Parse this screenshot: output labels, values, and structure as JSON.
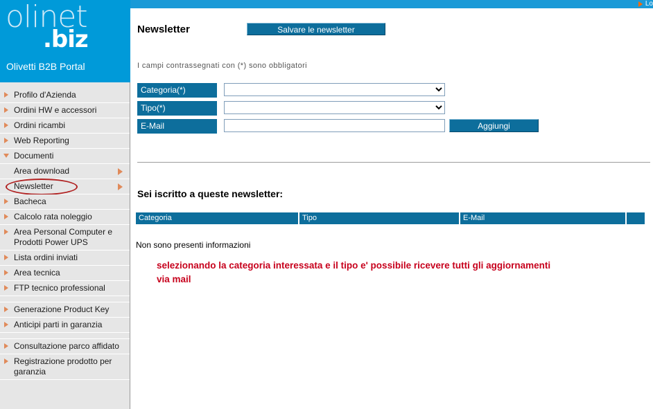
{
  "topbar": {
    "link_label": "Lo",
    "arrow_icon": "play-arrow-icon",
    "bg_color": "#1a9ad7"
  },
  "sidebar": {
    "logo": {
      "line1": "olinet",
      "line2": ".biz",
      "tagline": "Olivetti B2B Portal",
      "bg_color": "#009ad9"
    },
    "items": [
      {
        "label": "Profilo d'Azienda",
        "bullet": "right-arrow-icon",
        "sub": false,
        "submenu_arrow": false,
        "circled": false,
        "spacer_after": false
      },
      {
        "label": "Ordini HW e accessori",
        "bullet": "right-arrow-icon",
        "sub": false,
        "submenu_arrow": false,
        "circled": false,
        "spacer_after": false
      },
      {
        "label": "Ordini ricambi",
        "bullet": "right-arrow-icon",
        "sub": false,
        "submenu_arrow": false,
        "circled": false,
        "spacer_after": false
      },
      {
        "label": "Web Reporting",
        "bullet": "right-arrow-icon",
        "sub": false,
        "submenu_arrow": false,
        "circled": false,
        "spacer_after": false
      },
      {
        "label": "Documenti",
        "bullet": "down-arrow-icon",
        "sub": false,
        "submenu_arrow": false,
        "circled": false,
        "spacer_after": false
      },
      {
        "label": "Area download",
        "bullet": "none",
        "sub": true,
        "submenu_arrow": true,
        "circled": false,
        "spacer_after": false
      },
      {
        "label": "Newsletter",
        "bullet": "none",
        "sub": true,
        "submenu_arrow": true,
        "circled": true,
        "spacer_after": false
      },
      {
        "label": "Bacheca",
        "bullet": "right-arrow-icon",
        "sub": false,
        "submenu_arrow": false,
        "circled": false,
        "spacer_after": false
      },
      {
        "label": "Calcolo rata noleggio",
        "bullet": "right-arrow-icon",
        "sub": false,
        "submenu_arrow": false,
        "circled": false,
        "spacer_after": false
      },
      {
        "label": "Area Personal Computer e Prodotti Power UPS",
        "bullet": "right-arrow-icon",
        "sub": false,
        "submenu_arrow": false,
        "circled": false,
        "spacer_after": false
      },
      {
        "label": "Lista ordini inviati",
        "bullet": "right-arrow-icon",
        "sub": false,
        "submenu_arrow": false,
        "circled": false,
        "spacer_after": false
      },
      {
        "label": "Area tecnica",
        "bullet": "right-arrow-icon",
        "sub": false,
        "submenu_arrow": false,
        "circled": false,
        "spacer_after": false
      },
      {
        "label": "FTP tecnico professional",
        "bullet": "right-arrow-icon",
        "sub": false,
        "submenu_arrow": false,
        "circled": false,
        "spacer_after": true
      },
      {
        "label": "Generazione Product Key",
        "bullet": "right-arrow-icon",
        "sub": false,
        "submenu_arrow": false,
        "circled": false,
        "spacer_after": false
      },
      {
        "label": "Anticipi parti in garanzia",
        "bullet": "right-arrow-icon",
        "sub": false,
        "submenu_arrow": false,
        "circled": false,
        "spacer_after": true
      },
      {
        "label": "Consultazione parco affidato",
        "bullet": "right-arrow-icon",
        "sub": false,
        "submenu_arrow": false,
        "circled": false,
        "spacer_after": false
      },
      {
        "label": "Registrazione prodotto per garanzia",
        "bullet": "right-arrow-icon",
        "sub": false,
        "submenu_arrow": false,
        "circled": false,
        "spacer_after": false
      }
    ]
  },
  "main": {
    "page_title": "Newsletter",
    "save_button_label": "Salvare le newsletter",
    "required_note": "I campi contrassegnati con (*) sono obbligatori",
    "form": {
      "rows": [
        {
          "label": "Categoria(*)",
          "control": "select",
          "value": "",
          "options": [
            ""
          ]
        },
        {
          "label": "Tipo(*)",
          "control": "select",
          "value": "",
          "options": [
            ""
          ]
        },
        {
          "label": "E-Mail",
          "control": "input",
          "value": "",
          "placeholder": ""
        }
      ],
      "add_button_label": "Aggiungi"
    },
    "subscribed_title": "Sei iscritto a queste newsletter:",
    "table": {
      "columns": [
        "Categoria",
        "Tipo",
        "E-Mail",
        ""
      ],
      "rows": [],
      "empty_message": "Non sono presenti informazioni",
      "header_bg": "#0d6e9c"
    },
    "annotation": {
      "text": "selezionando la categoria interessata e il tipo e' possibile ricevere tutti gli aggiornamenti via mail",
      "color": "#c7001c"
    }
  }
}
